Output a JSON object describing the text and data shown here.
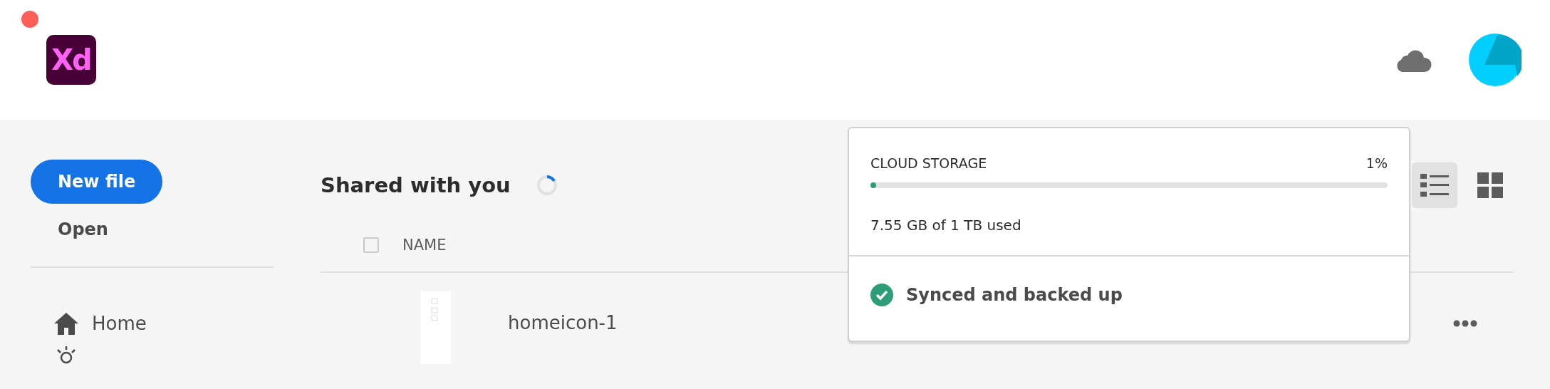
{
  "app": {
    "logo": "Xd"
  },
  "sidebar": {
    "new_button": "New file",
    "open_link": "Open",
    "items": [
      {
        "label": "Home",
        "selected": false
      }
    ]
  },
  "main": {
    "title": "Shared with you",
    "select_all": {
      "checked": false
    },
    "columns": [
      "NAME"
    ],
    "rows": [
      {
        "name": "homeicon-1"
      }
    ],
    "view_modes": [
      {
        "kind": "list",
        "selected": true
      },
      {
        "kind": "grid",
        "selected": false
      }
    ]
  },
  "storage_popover": {
    "label": "CLOUD STORAGE",
    "percent": "1%",
    "level": 0.01,
    "usage": "7.55 GB of 1 TB used",
    "status": "Synced and backed up"
  }
}
